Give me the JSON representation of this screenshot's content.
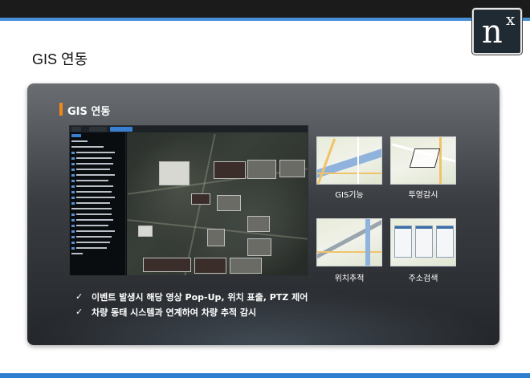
{
  "slide": {
    "title": "GIS 연동"
  },
  "logo": {
    "main": "n",
    "superscript": "x"
  },
  "panel": {
    "section_title": "GIS 연동",
    "accent_color": "#f28a1a",
    "thumbnails": [
      {
        "label": "GIS기능",
        "icon": "map-icon"
      },
      {
        "label": "투영감시",
        "icon": "polygon-map-icon"
      },
      {
        "label": "위치추적",
        "icon": "tracking-map-icon"
      },
      {
        "label": "주소검색",
        "icon": "address-search-icon"
      }
    ],
    "bullets": [
      "이벤트 발생시 해당 영상 Pop-Up, 위치 표출, PTZ 제어",
      "차량 동태 시스템과 연계하여 차량 추적 감시"
    ],
    "bullet_icon": "check-icon",
    "bullet_glyph": "✓"
  },
  "colors": {
    "top_bar": "#1b1b1b",
    "accent_blue": "#4a90d9",
    "panel_dark": "#23262a"
  }
}
